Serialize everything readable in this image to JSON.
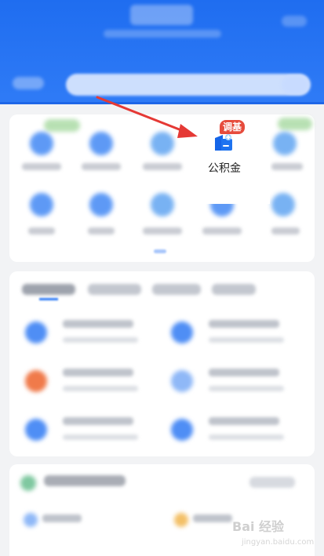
{
  "header": {
    "brand_color": "#1f6df0"
  },
  "highlight": {
    "label": "公积金",
    "badge": "调基",
    "icon": "housing-fund-icon",
    "badge_color": "#e64b3c"
  },
  "annotation": {
    "arrow_color": "#e53935"
  },
  "watermark": {
    "brand": "Bai 经验",
    "domain": "jingyan.baidu.com"
  }
}
